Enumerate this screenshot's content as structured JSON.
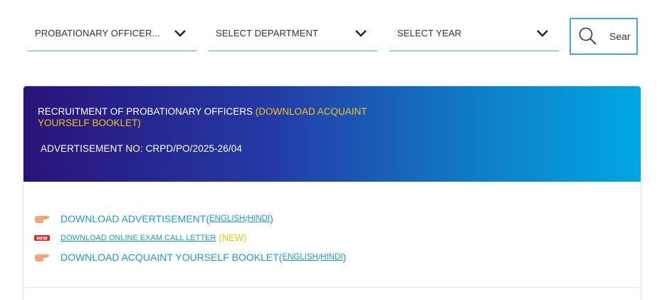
{
  "filters": {
    "post": {
      "value": "PROBATIONARY OFFICER..."
    },
    "department": {
      "value": "SELECT DEPARTMENT"
    },
    "year": {
      "value": "SELECT YEAR"
    },
    "search_label": "Sear"
  },
  "card": {
    "title_main": "RECRUITMENT OF PROBATIONARY OFFICERS",
    "title_highlight": "(DOWNLOAD ACQUAINT YOURSELF BOOKLET)",
    "advertisement": "ADVERTISEMENT NO: CRPD/PO/2025-26/04",
    "links": {
      "advertisement": {
        "label": "DOWNLOAD ADVERTISEMENT",
        "english": "ENGLISH",
        "hindi": "HINDI"
      },
      "call_letter": {
        "label": "DOWNLOAD ONLINE EXAM CALL LETTER",
        "tag": "(NEW)"
      },
      "booklet": {
        "label": "DOWNLOAD ACQUAINT YOURSELF BOOKLET",
        "english": "ENGLISH",
        "hindi": "HINDI"
      }
    }
  },
  "colors": {
    "accent": "#1a9ad6",
    "highlight": "#f2c21b",
    "header_gradient_start": "#29137a",
    "header_gradient_end": "#00a6e2",
    "border": "#4aa3df"
  },
  "icons": {
    "dropdown": "chevron-down-icon",
    "search": "magnifier-icon",
    "bullet": "pointing-hand-icon",
    "new": "new-badge-icon"
  }
}
